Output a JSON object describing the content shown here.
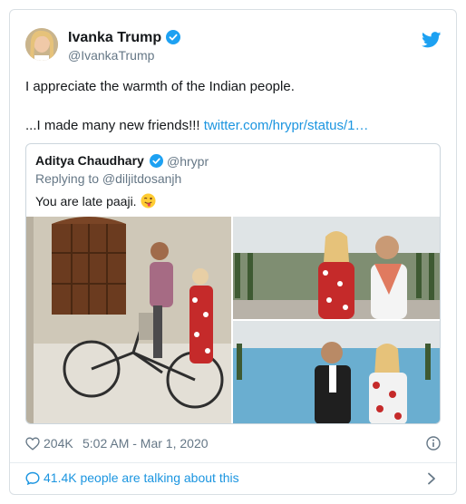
{
  "tweet": {
    "author_name": "Ivanka Trump",
    "author_handle": "@IvankaTrump",
    "text_line1": "I appreciate the warmth of the Indian people.",
    "text_line2_prefix": "...I made many new friends!!! ",
    "text_link": "twitter.com/hrypr/status/1…",
    "likes": "204K",
    "timestamp": "5:02 AM - Mar 1, 2020",
    "talking": "41.4K people are talking about this"
  },
  "quoted": {
    "author_name": "Aditya Chaudhary",
    "author_handle": "@hrypr",
    "replying_to": "Replying to @diljitdosanjh",
    "text": "You are late paaji."
  },
  "colors": {
    "link": "#1b95e0",
    "verified": "#1da1f2",
    "secondary_text": "#657786"
  },
  "icons": [
    "twitter-bird-icon",
    "verified-badge-icon",
    "heart-icon",
    "info-icon",
    "speech-bubble-icon",
    "chevron-right-icon",
    "winking-tongue-emoji"
  ]
}
